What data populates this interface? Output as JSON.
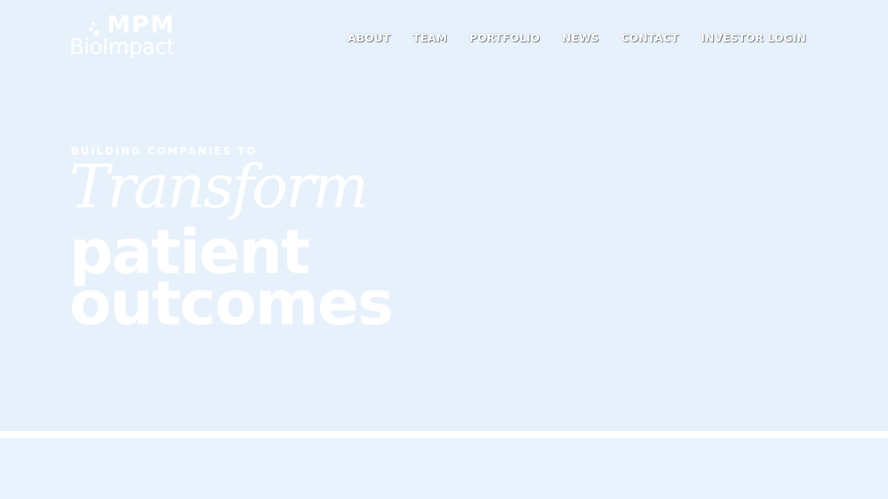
{
  "logo": {
    "top": "MPM",
    "bottom": "BioImpact"
  },
  "nav": {
    "items": [
      {
        "label": "ABOUT"
      },
      {
        "label": "TEAM"
      },
      {
        "label": "PORTFOLIO"
      },
      {
        "label": "NEWS"
      },
      {
        "label": "CONTACT"
      },
      {
        "label": "INVESTOR LOGIN"
      }
    ]
  },
  "hero": {
    "eyebrow": "BUILDING COMPANIES TO",
    "script": "Transform",
    "headline_line1": "patient",
    "headline_line2": "outcomes"
  },
  "colors": {
    "background": "#e7f1fc",
    "text": "#ffffff",
    "divider": "#ffffff"
  }
}
